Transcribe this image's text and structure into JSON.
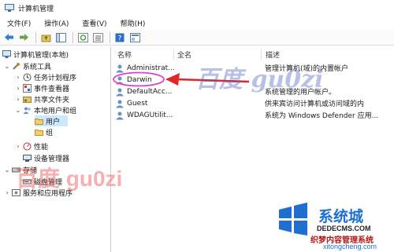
{
  "window": {
    "title": "计算机管理"
  },
  "menu": [
    "文件(F)",
    "操作(A)",
    "查看(V)",
    "帮助(H)"
  ],
  "tree": {
    "root": "计算机管理(本地)",
    "system_tools": "系统工具",
    "task_scheduler": "任务计划程序",
    "event_viewer": "事件查看器",
    "shared_folders": "共享文件夹",
    "local_users_groups": "本地用户和组",
    "users": "用户",
    "groups": "组",
    "performance": "性能",
    "device_manager": "设备管理器",
    "storage": "存储",
    "disk_management": "磁盘管理",
    "services_apps": "服务和应用程序"
  },
  "columns": {
    "name": "名称",
    "fullname": "全名",
    "desc": "描述"
  },
  "users": [
    {
      "name": "Administrat...",
      "desc": "管理计算机(域)的内置帐户"
    },
    {
      "name": "Darwin",
      "desc": ""
    },
    {
      "name": "DefaultAcc...",
      "desc": "系统管理的用户帐户。"
    },
    {
      "name": "Guest",
      "desc": "供来宾访问计算机或访问域的内"
    },
    {
      "name": "WDAGUtilit...",
      "desc": "系统为 Windows Defender 应用..."
    }
  ],
  "watermarks": {
    "top": "百度 gu0zi",
    "bottom": "百度 gu0zi"
  },
  "logo": {
    "brand": "系统城",
    "site": "DEDECMS.COM",
    "tagline": "织梦内容管理系统",
    "url": "xitongcheng.com"
  },
  "colors": {
    "highlight": "#cce8ff",
    "annotation_red": "#e3262b",
    "annotation_circle": "#e040d0",
    "logo_blue": "#1e6fd0"
  }
}
